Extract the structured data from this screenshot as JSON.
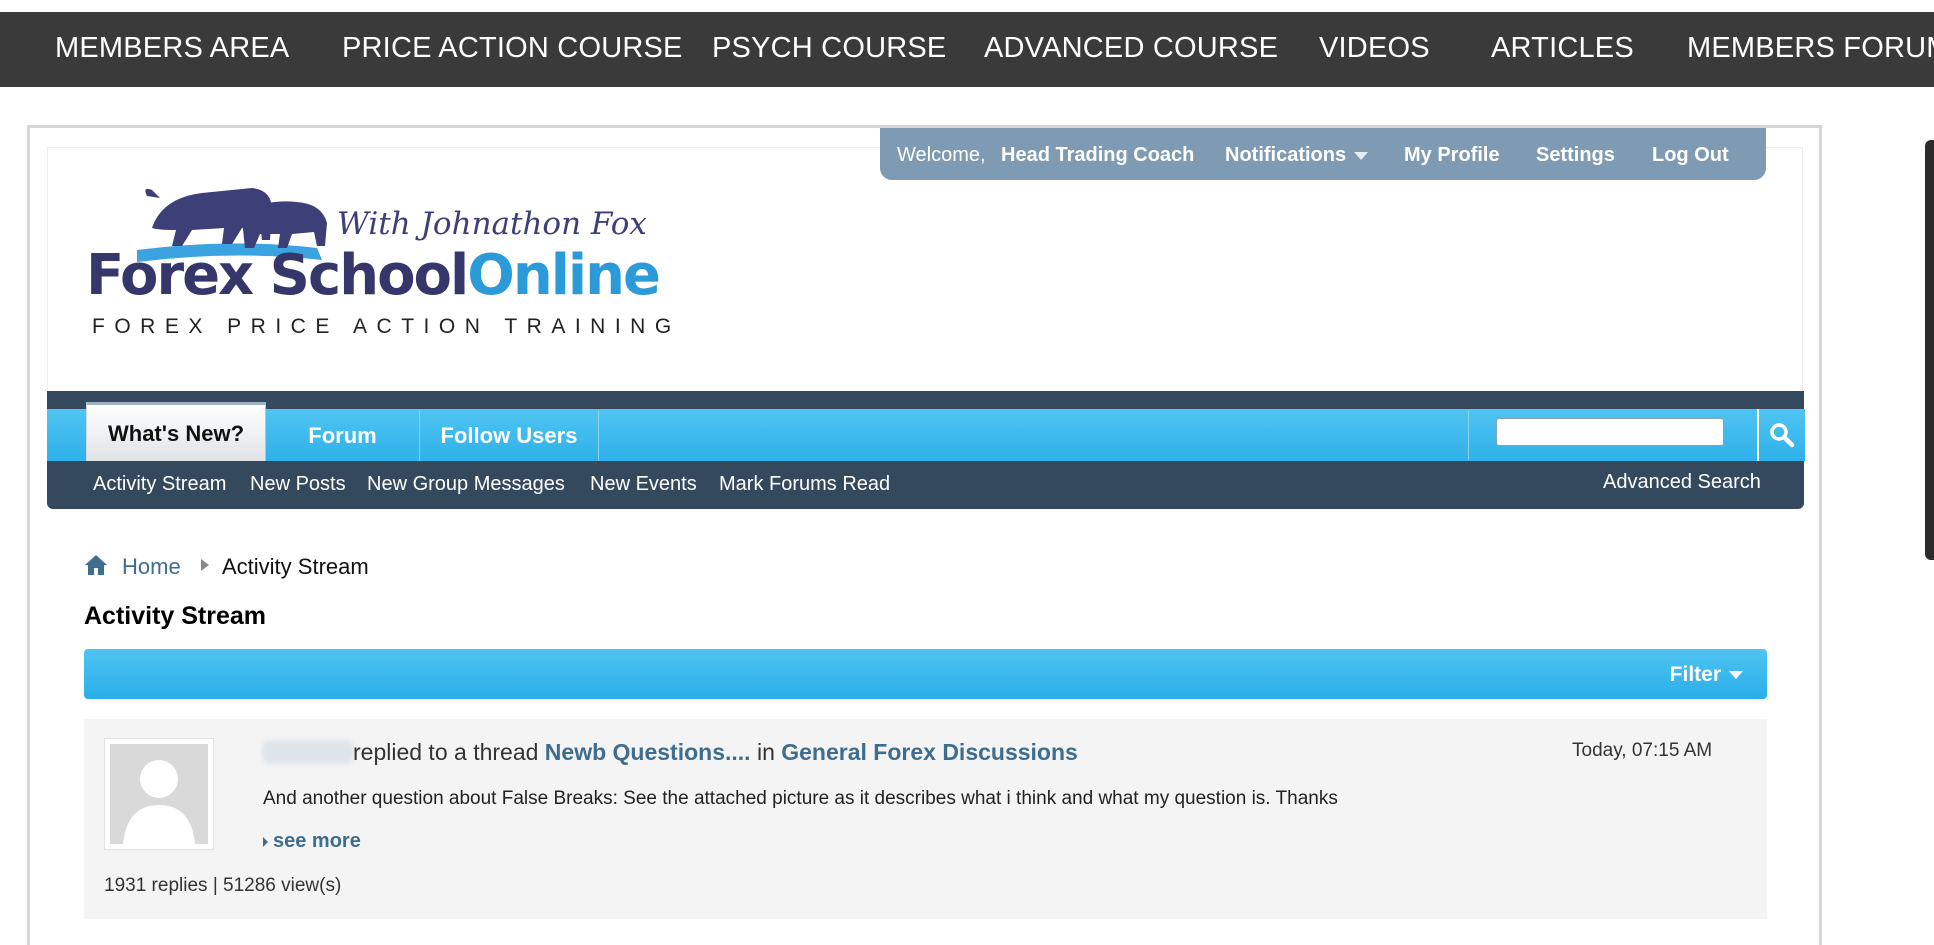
{
  "top_nav": {
    "items": [
      "MEMBERS AREA",
      "PRICE ACTION COURSE",
      "PSYCH COURSE",
      "ADVANCED COURSE",
      "VIDEOS",
      "ARTICLES",
      "MEMBERS FORUM"
    ]
  },
  "welcome": {
    "prefix": "Welcome,",
    "username": "Head Trading Coach",
    "notifications": "Notifications",
    "my_profile": "My Profile",
    "settings": "Settings",
    "log_out": "Log Out"
  },
  "logo": {
    "with_text": "With Johnathon Fox",
    "brand_a": "Forex School",
    "brand_b": "Online",
    "tagline": "FOREX PRICE ACTION TRAINING"
  },
  "main_tabs": [
    "What's New?",
    "Forum",
    "Follow Users"
  ],
  "search": {
    "placeholder": ""
  },
  "sub_nav": {
    "items": [
      "Activity Stream",
      "New Posts",
      "New Group Messages",
      "New Events",
      "Mark Forums Read"
    ],
    "advanced_search": "Advanced Search"
  },
  "breadcrumb": {
    "home": "Home",
    "current": "Activity Stream"
  },
  "page_title": "Activity Stream",
  "filter_label": "Filter",
  "activity": {
    "action": "replied to a thread",
    "thread": "Newb Questions....",
    "in": "in",
    "forum": "General Forex Discussions",
    "timestamp": "Today, 07:15 AM",
    "excerpt": "And another question about False Breaks: See the attached picture as it describes what i think and what my question is. Thanks",
    "see_more": "see more",
    "replies": "1931 replies",
    "separator": "|",
    "views": "51286 view(s)"
  },
  "colors": {
    "top_nav_bg": "#3a3a3a",
    "accent_blue": "#2fb1ea",
    "dark_navy": "#34495d",
    "welcome_bg": "#7e9bb3",
    "link_blue": "#3e6d8e"
  }
}
